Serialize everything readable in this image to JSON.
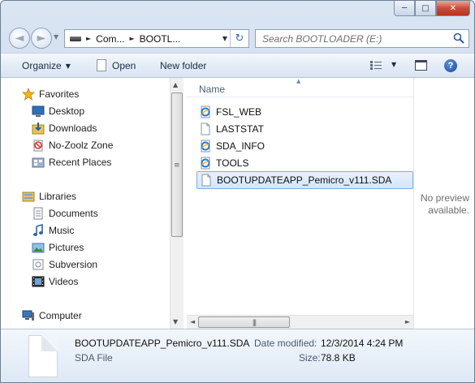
{
  "window": {
    "minimize_glyph": "─",
    "maximize_glyph": "□",
    "close_glyph": "✕"
  },
  "address_bar": {
    "back_glyph": "◄",
    "forward_glyph": "►",
    "history_glyph": "▼",
    "crumbs": [
      "Com...",
      "BOOTL..."
    ],
    "crumb_separator": "►",
    "dropdown_glyph": "▼",
    "refresh_glyph": "↻"
  },
  "search": {
    "placeholder": "Search BOOTLOADER (E:)"
  },
  "toolbar": {
    "organize_label": "Organize",
    "open_label": "Open",
    "new_folder_label": "New folder",
    "dropdown_glyph": "▼",
    "help_glyph": "?"
  },
  "navigation": {
    "favorites": {
      "label": "Favorites",
      "items": [
        {
          "label": "Desktop",
          "icon": "desktop-icon"
        },
        {
          "label": "Downloads",
          "icon": "downloads-icon"
        },
        {
          "label": "No-Zoolz Zone",
          "icon": "no-sync-icon"
        },
        {
          "label": "Recent Places",
          "icon": "recent-places-icon"
        }
      ]
    },
    "libraries": {
      "label": "Libraries",
      "items": [
        {
          "label": "Documents",
          "icon": "documents-icon"
        },
        {
          "label": "Music",
          "icon": "music-icon"
        },
        {
          "label": "Pictures",
          "icon": "pictures-icon"
        },
        {
          "label": "Subversion",
          "icon": "subversion-icon"
        },
        {
          "label": "Videos",
          "icon": "videos-icon"
        }
      ]
    },
    "computer": {
      "label": "Computer",
      "icon": "computer-icon"
    }
  },
  "file_list": {
    "column_header": "Name",
    "sort_glyph": "▲",
    "items": [
      {
        "name": "FSL_WEB",
        "icon": "internet-shortcut-icon",
        "selected": false
      },
      {
        "name": "LASTSTAT",
        "icon": "text-file-icon",
        "selected": false
      },
      {
        "name": "SDA_INFO",
        "icon": "internet-shortcut-icon",
        "selected": false
      },
      {
        "name": "TOOLS",
        "icon": "internet-shortcut-icon",
        "selected": false
      },
      {
        "name": "BOOTUPDATEAPP_Pemicro_v111.SDA",
        "icon": "generic-file-icon",
        "selected": true
      }
    ]
  },
  "preview": {
    "line1": "No preview",
    "line2": "available."
  },
  "details": {
    "file_name": "BOOTUPDATEAPP_Pemicro_v111.SDA",
    "file_type": "SDA File",
    "date_label": "Date modified:",
    "date_value": "12/3/2014 4:24 PM",
    "size_label": "Size:",
    "size_value": "78.8 KB"
  },
  "colors": {
    "accent": "#2e6fb7",
    "selection_border": "#84acdd",
    "selection_fill": "#d4e6fa"
  }
}
